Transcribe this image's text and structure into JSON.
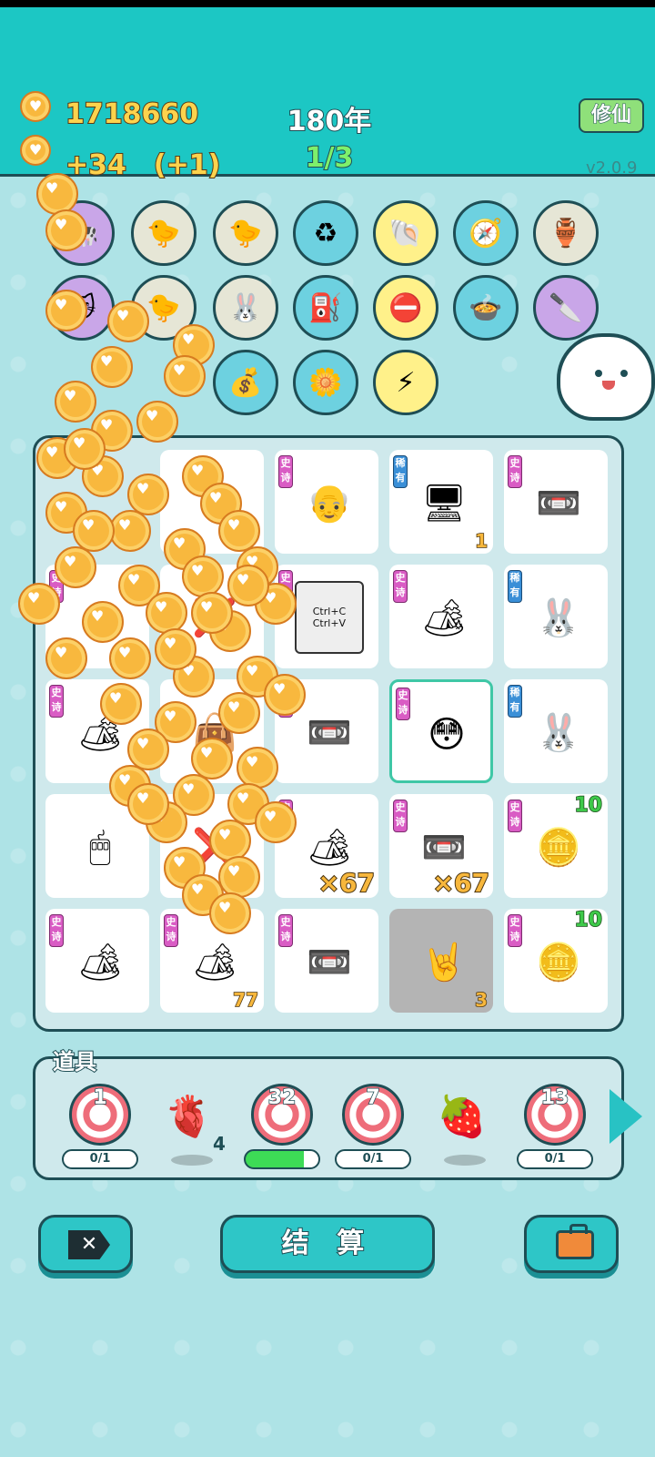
{
  "header": {
    "coins": "1718660",
    "income": "+34　(+1)",
    "year": "180年",
    "round": "1/3",
    "mode_button": "修仙",
    "version": "v2.0.9"
  },
  "collected_icons": [
    {
      "name": "cow-twins-icon",
      "glyph": "🐄",
      "bg": "#c9a6e8"
    },
    {
      "name": "chick-egg-icon",
      "glyph": "🐤",
      "bg": "#e6e6d6"
    },
    {
      "name": "chick-egg-icon",
      "glyph": "🐤",
      "bg": "#e6e6d6"
    },
    {
      "name": "trash-bag-icon",
      "glyph": "♻",
      "bg": "#6dd1e0"
    },
    {
      "name": "shell-icon",
      "glyph": "🐚",
      "bg": "#fff18a"
    },
    {
      "name": "compass-icon",
      "glyph": "🧭",
      "bg": "#6dd1e0"
    },
    {
      "name": "gold-pot-icon",
      "glyph": "🏺",
      "bg": "#e6e6d6"
    },
    {
      "name": "pink-cat-icon",
      "glyph": "🐱",
      "bg": "#c9a6e8"
    },
    {
      "name": "chick-icon",
      "glyph": "🐤",
      "bg": "#e6e6d6"
    },
    {
      "name": "rabbit-icon",
      "glyph": "🐰",
      "bg": "#e6e6d6"
    },
    {
      "name": "pump-icon",
      "glyph": "⛽",
      "bg": "#6dd1e0"
    },
    {
      "name": "no-entry-icon",
      "glyph": "⛔",
      "bg": "#fff18a"
    },
    {
      "name": "rice-cooker-icon",
      "glyph": "🍲",
      "bg": "#6dd1e0"
    },
    {
      "name": "cleaver-icon",
      "glyph": "🔪",
      "bg": "#c9a6e8"
    },
    {
      "name": "money-bag-icon",
      "glyph": "💰",
      "bg": "#6dd1e0"
    },
    {
      "name": "flower-pot-icon",
      "glyph": "🌼",
      "bg": "#6dd1e0"
    },
    {
      "name": "lightning-icon",
      "glyph": "⚡",
      "bg": "#fff18a"
    }
  ],
  "board": [
    {
      "tag": "",
      "glyph": "",
      "count": ""
    },
    {
      "tag": "史诗",
      "glyph": "👴",
      "count": ""
    },
    {
      "tag": "稀有",
      "glyph": "🖥",
      "count": "1"
    },
    {
      "tag": "史诗",
      "glyph": "📼",
      "count": ""
    },
    {
      "tag": "史诗",
      "glyph": "",
      "count": ""
    },
    {
      "tag": "",
      "glyph": "❌",
      "count": ""
    },
    {
      "tag": "史诗",
      "glyph": "📋",
      "count": "",
      "label": "Ctrl+C\nCtrl+V"
    },
    {
      "tag": "史诗",
      "glyph": "🏕",
      "count": ""
    },
    {
      "tag": "稀有",
      "glyph": "🐰",
      "count": ""
    },
    {
      "tag": "史诗",
      "glyph": "🏕",
      "count": ""
    },
    {
      "tag": "",
      "glyph": "👜",
      "count": "4"
    },
    {
      "tag": "史诗",
      "glyph": "📼",
      "count": ""
    },
    {
      "tag": "史诗",
      "glyph": "😳",
      "count": "",
      "selected": true
    },
    {
      "tag": "稀有",
      "glyph": "🐰",
      "count": ""
    },
    {
      "tag": "",
      "glyph": "🖱",
      "count": ""
    },
    {
      "tag": "",
      "glyph": "❌",
      "count": ""
    },
    {
      "tag": "史诗",
      "glyph": "🏕",
      "mult": "×67"
    },
    {
      "tag": "史诗",
      "glyph": "📼",
      "mult": "×67"
    },
    {
      "tag": "史诗",
      "glyph": "🪙",
      "top": "10"
    },
    {
      "tag": "史诗",
      "glyph": "🏕",
      "count": ""
    },
    {
      "tag": "史诗",
      "glyph": "🏕",
      "count": "77"
    },
    {
      "tag": "史诗",
      "glyph": "📼",
      "count": ""
    },
    {
      "tag": "",
      "glyph": "🤘",
      "count": "3",
      "gray": true
    },
    {
      "tag": "史诗",
      "glyph": "🪙",
      "top": "10"
    }
  ],
  "props": {
    "label": "道具",
    "items": [
      {
        "type": "target",
        "value": "1",
        "bar": "0/1"
      },
      {
        "type": "liver",
        "glyph": "🫀",
        "count": "4"
      },
      {
        "type": "target",
        "value": "32",
        "bar": "",
        "progress": 0.8
      },
      {
        "type": "target",
        "value": "7",
        "bar": "0/1"
      },
      {
        "type": "strawberry",
        "glyph": "🍓"
      },
      {
        "type": "target",
        "value": "13",
        "bar": "0/1"
      }
    ]
  },
  "buttons": {
    "settle": "结 算"
  }
}
